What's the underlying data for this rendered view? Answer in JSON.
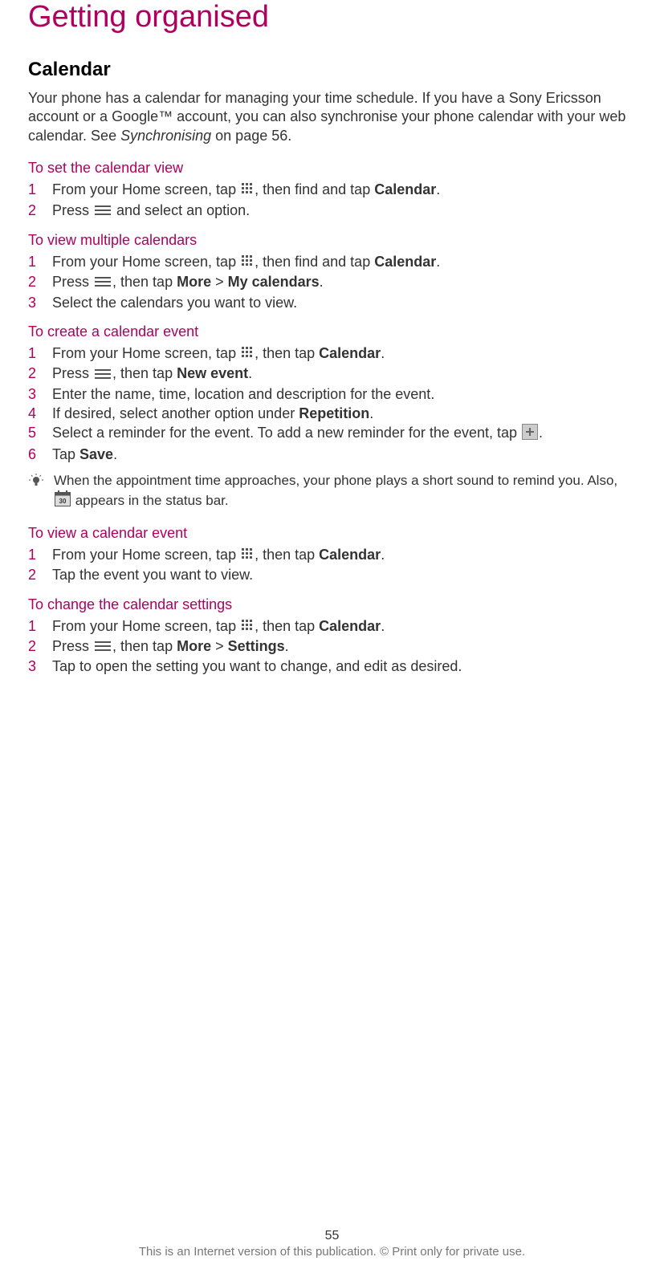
{
  "chapter_title": "Getting organised",
  "section_title": "Calendar",
  "intro_pre": "Your phone has a calendar for managing your time schedule. If you have a Sony Ericsson account or a Google™ account, you can also synchronise your phone calendar with your web calendar. See ",
  "intro_link": "Synchronising",
  "intro_post": " on page 56.",
  "s1": {
    "heading": "To set the calendar view",
    "steps": [
      {
        "n": "1",
        "pre": "From your Home screen, tap ",
        "mid": ", then find and tap ",
        "bold1": "Calendar",
        "post": "."
      },
      {
        "n": "2",
        "pre": "Press ",
        "post": " and select an option."
      }
    ]
  },
  "s2": {
    "heading": "To view multiple calendars",
    "steps": [
      {
        "n": "1",
        "pre": "From your Home screen, tap ",
        "mid": ", then find and tap ",
        "bold1": "Calendar",
        "post": "."
      },
      {
        "n": "2",
        "pre": "Press ",
        "mid": ", then tap ",
        "bold1": "More",
        "sep": " > ",
        "bold2": "My calendars",
        "post": "."
      },
      {
        "n": "3",
        "text": "Select the calendars you want to view."
      }
    ]
  },
  "s3": {
    "heading": "To create a calendar event",
    "steps": [
      {
        "n": "1",
        "pre": "From your Home screen, tap ",
        "mid": ", then tap ",
        "bold1": "Calendar",
        "post": "."
      },
      {
        "n": "2",
        "pre": "Press ",
        "mid": ", then tap ",
        "bold1": "New event",
        "post": "."
      },
      {
        "n": "3",
        "text": "Enter the name, time, location and description for the event."
      },
      {
        "n": "4",
        "pre": "If desired, select another option under ",
        "bold1": "Repetition",
        "post": "."
      },
      {
        "n": "5",
        "pre": "Select a reminder for the event. To add a new reminder for the event, tap ",
        "post": "."
      },
      {
        "n": "6",
        "pre": "Tap ",
        "bold1": "Save",
        "post": "."
      }
    ],
    "tip_pre": "When the appointment time approaches, your phone plays a short sound to remind you. Also, ",
    "tip_post": " appears in the status bar."
  },
  "s4": {
    "heading": "To view a calendar event",
    "steps": [
      {
        "n": "1",
        "pre": "From your Home screen, tap ",
        "mid": ", then tap ",
        "bold1": "Calendar",
        "post": "."
      },
      {
        "n": "2",
        "text": "Tap the event you want to view."
      }
    ]
  },
  "s5": {
    "heading": "To change the calendar settings",
    "steps": [
      {
        "n": "1",
        "pre": "From your Home screen, tap ",
        "mid": ", then tap ",
        "bold1": "Calendar",
        "post": "."
      },
      {
        "n": "2",
        "pre": "Press ",
        "mid": ", then tap ",
        "bold1": "More",
        "sep": " > ",
        "bold2": "Settings",
        "post": "."
      },
      {
        "n": "3",
        "text": "Tap to open the setting you want to change, and edit as desired."
      }
    ]
  },
  "page_number": "55",
  "copyright": "This is an Internet version of this publication. © Print only for private use."
}
